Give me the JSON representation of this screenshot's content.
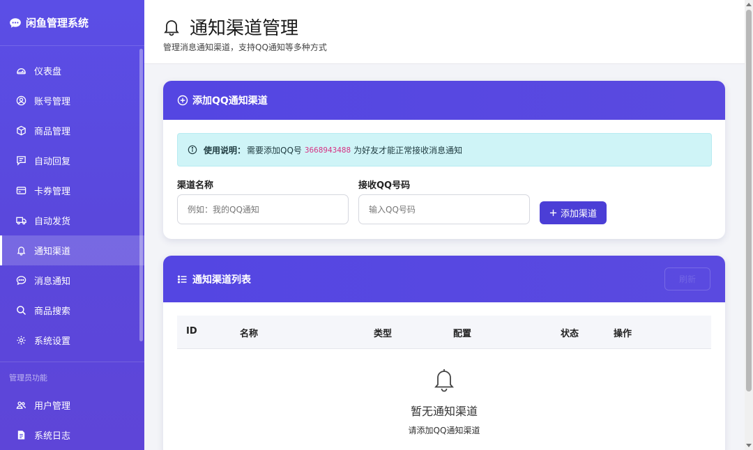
{
  "app": {
    "brand": "闲鱼管理系统"
  },
  "sidebar": {
    "items": [
      {
        "label": "仪表盘",
        "icon": "speedometer-icon"
      },
      {
        "label": "账号管理",
        "icon": "user-circle-icon"
      },
      {
        "label": "商品管理",
        "icon": "box-icon"
      },
      {
        "label": "自动回复",
        "icon": "chat-lines-icon"
      },
      {
        "label": "卡券管理",
        "icon": "card-icon"
      },
      {
        "label": "自动发货",
        "icon": "truck-icon"
      },
      {
        "label": "通知渠道",
        "icon": "bell-icon",
        "active": true
      },
      {
        "label": "消息通知",
        "icon": "chat-dots-icon"
      },
      {
        "label": "商品搜索",
        "icon": "search-icon"
      },
      {
        "label": "系统设置",
        "icon": "gear-icon"
      }
    ],
    "admin_section_label": "管理员功能",
    "admin_items": [
      {
        "label": "用户管理",
        "icon": "people-icon"
      },
      {
        "label": "系统日志",
        "icon": "document-icon"
      }
    ]
  },
  "header": {
    "title": "通知渠道管理",
    "subtitle": "管理消息通知渠道，支持QQ通知等多种方式"
  },
  "add_card": {
    "title": "添加QQ通知渠道",
    "notice_label": "使用说明：",
    "notice_before": "需要添加QQ号",
    "notice_qq": "3668943488",
    "notice_after": "为好友才能正常接收消息通知",
    "name_label": "渠道名称",
    "name_placeholder": "例如：我的QQ通知",
    "qq_label": "接收QQ号码",
    "qq_placeholder": "输入QQ号码",
    "add_button": "添加渠道"
  },
  "list_card": {
    "title": "通知渠道列表",
    "refresh_label": "刷新",
    "columns": [
      "ID",
      "名称",
      "类型",
      "配置",
      "状态",
      "操作"
    ],
    "empty_title": "暂无通知渠道",
    "empty_sub": "请添加QQ通知渠道"
  },
  "colors": {
    "accent": "#4b3ed6",
    "sidebar": "#5a48dc",
    "notice_bg": "#cff4f7",
    "qq_highlight": "#d63384"
  }
}
